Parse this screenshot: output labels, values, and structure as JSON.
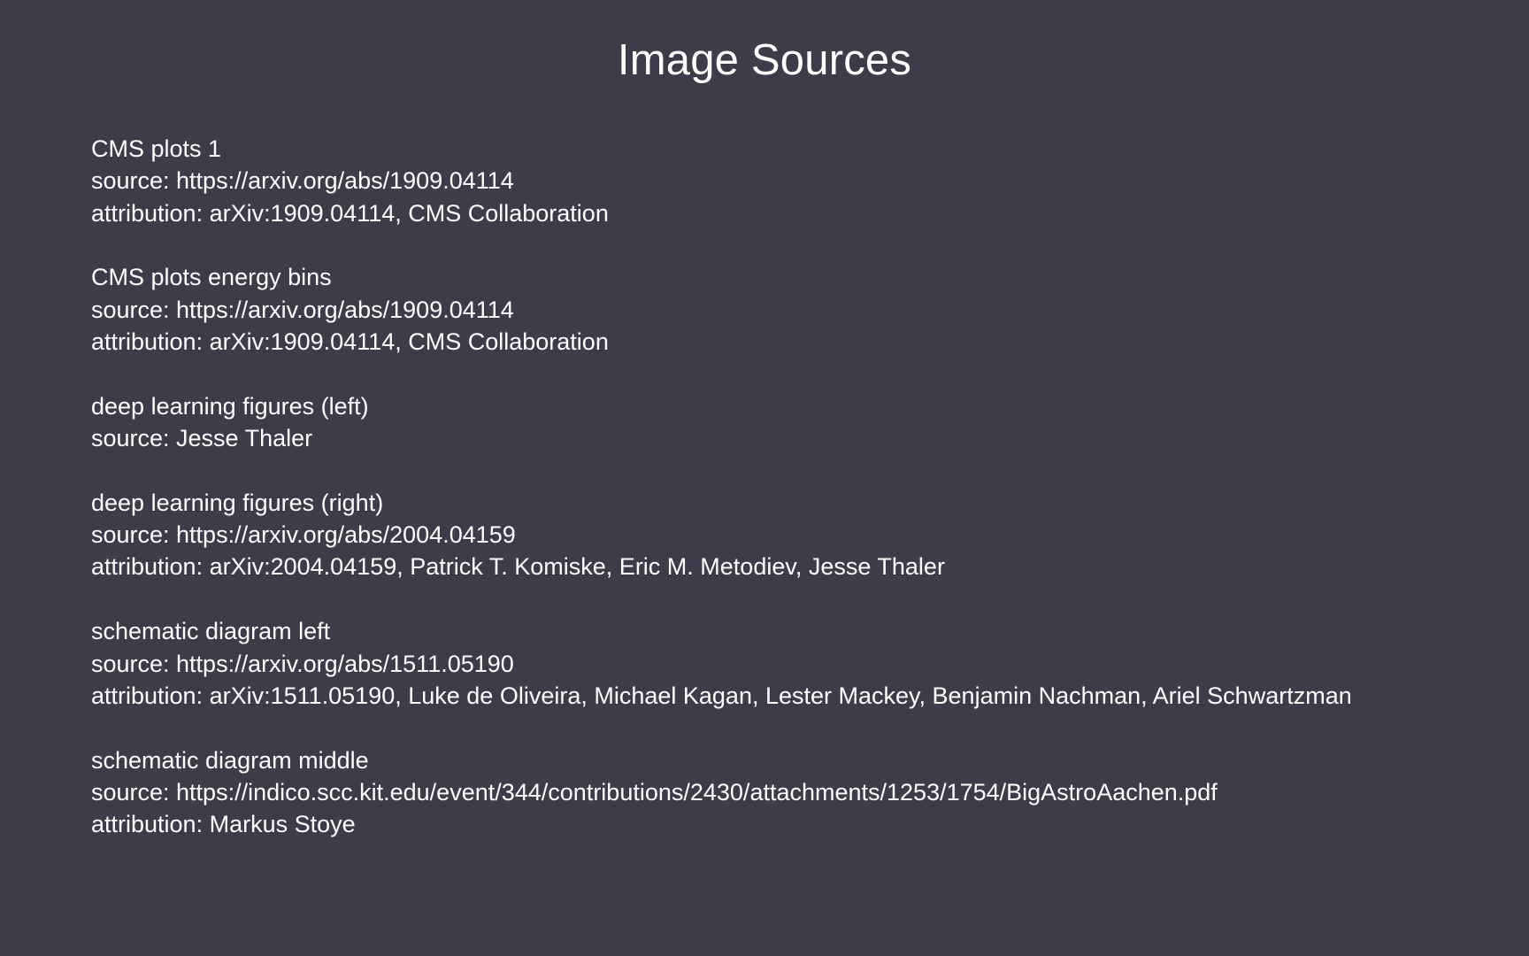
{
  "title": "Image Sources",
  "entries": [
    {
      "name": "CMS plots 1",
      "source": "source: https://arxiv.org/abs/1909.04114",
      "attribution": "attribution: arXiv:1909.04114, CMS Collaboration"
    },
    {
      "name": "CMS plots energy bins",
      "source": "source: https://arxiv.org/abs/1909.04114",
      "attribution": "attribution: arXiv:1909.04114, CMS Collaboration"
    },
    {
      "name": "deep learning figures (left)",
      "source": "source: Jesse Thaler"
    },
    {
      "name": "deep learning figures (right)",
      "source": "source: https://arxiv.org/abs/2004.04159",
      "attribution": "attribution: arXiv:2004.04159, Patrick T. Komiske, Eric M. Metodiev, Jesse Thaler"
    },
    {
      "name": "schematic diagram left",
      "source": "source: https://arxiv.org/abs/1511.05190",
      "attribution": "attribution: arXiv:1511.05190, Luke de Oliveira, Michael Kagan, Lester Mackey, Benjamin Nachman, Ariel Schwartzman"
    },
    {
      "name": "schematic diagram middle",
      "source": "source: https://indico.scc.kit.edu/event/344/contributions/2430/attachments/1253/1754/BigAstroAachen.pdf",
      "attribution": "attribution: Markus Stoye"
    }
  ]
}
